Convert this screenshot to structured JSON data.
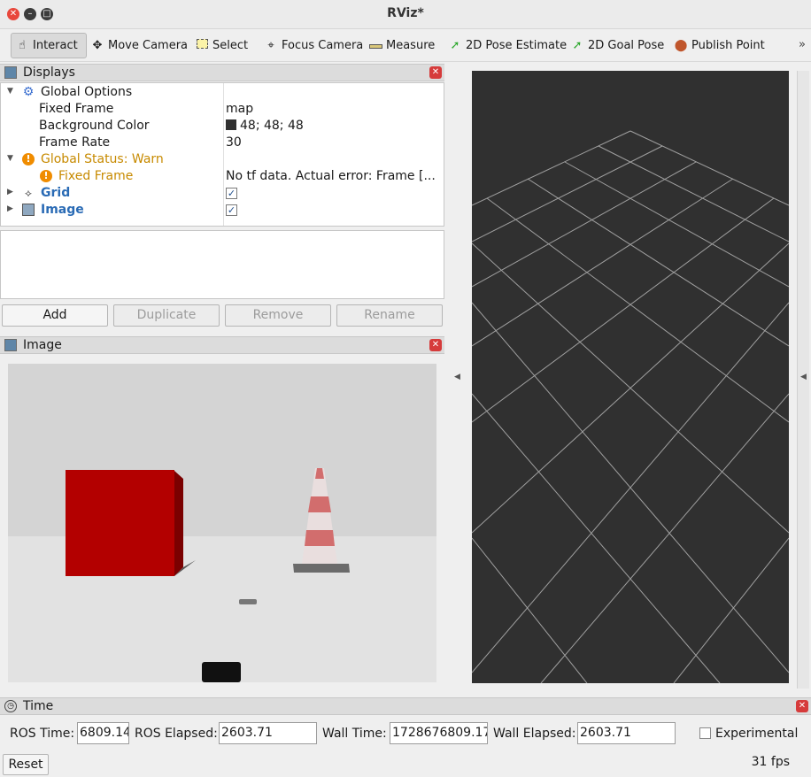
{
  "window": {
    "title": "RViz*"
  },
  "toolbar": {
    "tools": [
      {
        "label": "Interact",
        "icon": "hand-pointer-icon",
        "active": true
      },
      {
        "label": "Move Camera",
        "icon": "move-camera-icon"
      },
      {
        "label": "Select",
        "icon": "select-box-icon"
      },
      {
        "label": "Focus Camera",
        "icon": "crosshair-icon"
      },
      {
        "label": "Measure",
        "icon": "ruler-icon"
      },
      {
        "label": "2D Pose Estimate",
        "icon": "green-arrow-icon"
      },
      {
        "label": "2D Goal Pose",
        "icon": "green-arrow-icon"
      },
      {
        "label": "Publish Point",
        "icon": "map-pin-icon"
      }
    ],
    "more": "»"
  },
  "displays_panel": {
    "title": "Displays",
    "tree": {
      "global_options": "Global Options",
      "fixed_frame_label": "Fixed Frame",
      "fixed_frame_value": "map",
      "background_color_label": "Background Color",
      "background_color_value": "48; 48; 48",
      "frame_rate_label": "Frame Rate",
      "frame_rate_value": "30",
      "global_status": "Global Status: Warn",
      "status_fixed_frame": "Fixed Frame",
      "status_fixed_frame_value": "No tf data.  Actual error: Frame [...",
      "grid": "Grid",
      "image": "Image"
    },
    "buttons": {
      "add": "Add",
      "duplicate": "Duplicate",
      "remove": "Remove",
      "rename": "Rename"
    }
  },
  "image_panel": {
    "title": "Image"
  },
  "time_panel": {
    "title": "Time",
    "ros_time_label": "ROS Time:",
    "ros_time_value": "6809.14",
    "ros_elapsed_label": "ROS Elapsed:",
    "ros_elapsed_value": "2603.71",
    "wall_time_label": "Wall Time:",
    "wall_time_value": "1728676809.17",
    "wall_elapsed_label": "Wall Elapsed:",
    "wall_elapsed_value": "2603.71",
    "experimental_label": "Experimental",
    "reset_label": "Reset",
    "fps": "31 fps"
  },
  "colors": {
    "viewport_bg": "#303030",
    "grid_line": "#a0a0a0",
    "warn": "#c78a00",
    "link_blue": "#2a6bb5"
  }
}
